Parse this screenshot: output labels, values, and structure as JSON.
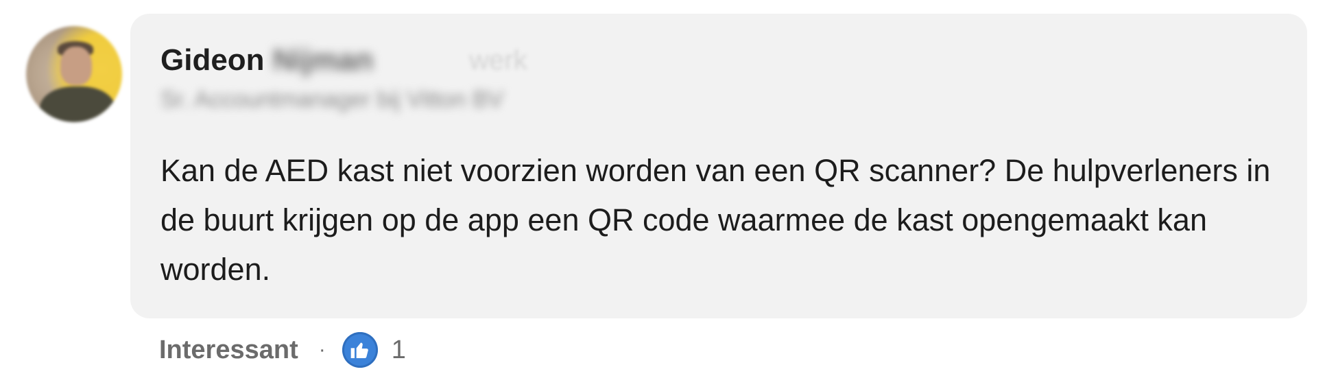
{
  "comment": {
    "author_first_name": "Gideon",
    "author_last_name": "Nijman",
    "author_extra": "werk",
    "author_headline": "Sr. Accountmanager bij Vitton BV",
    "text": "Kan de AED kast niet voorzien worden van een QR scanner? De hulpverleners in de buurt krijgen op de app een QR code waarmee de kast opengemaakt kan worden."
  },
  "footer": {
    "reaction_label": "Interessant",
    "separator": "·",
    "reaction_icon": "thumbs-up-icon",
    "reaction_count": "1"
  },
  "colors": {
    "bubble_background": "#f2f2f2",
    "reaction_icon_blue": "#3b82d9",
    "avatar_accent": "#f0cc3e"
  }
}
